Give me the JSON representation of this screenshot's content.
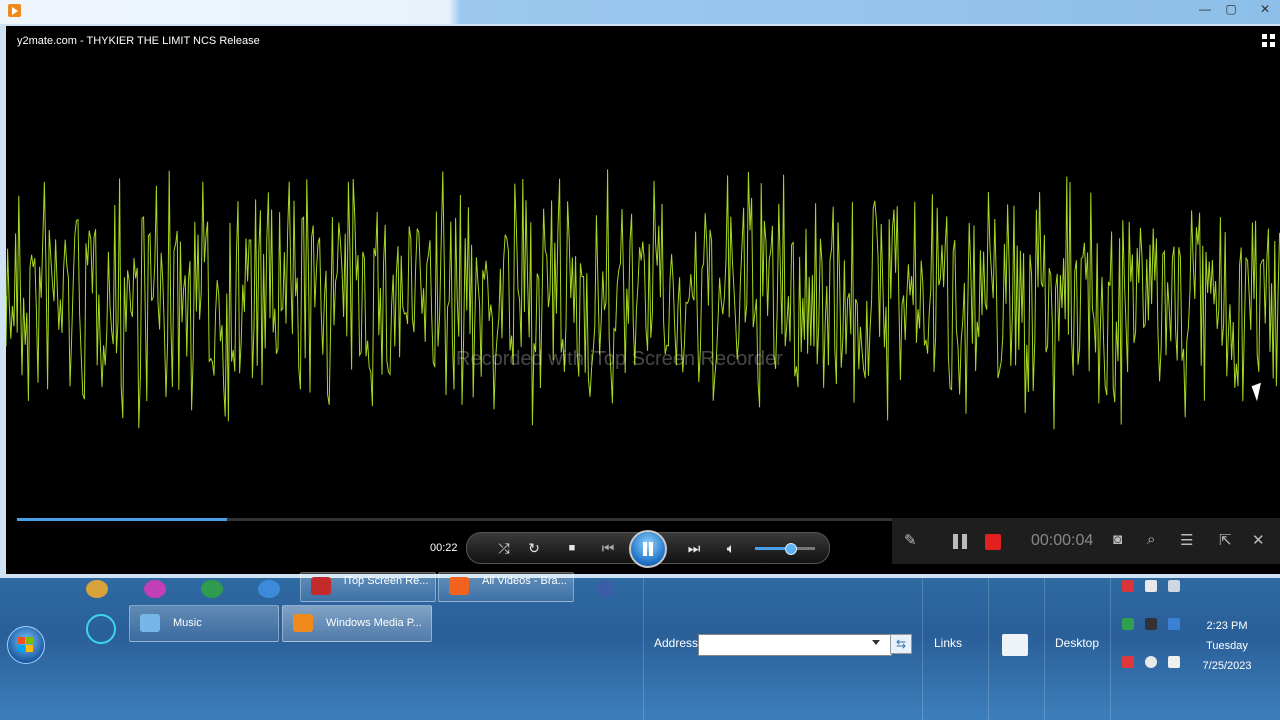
{
  "window": {
    "video_title": "y2mate.com - THYKIER  THE LIMIT NCS Release",
    "watermark": "Recorded with iTop Screen Recorder",
    "minimize": "—",
    "maximize": "▢",
    "close": "✕"
  },
  "player": {
    "elapsed": "00:22",
    "seek_progress": 0.24,
    "volume_level": 0.58,
    "icons": [
      "shuffle-icon",
      "repeat-icon",
      "stop-icon",
      "previous-icon",
      "pause-icon",
      "next-icon",
      "volume-icon"
    ]
  },
  "recorder": {
    "elapsed": "00:00:04",
    "stop_color": "#e32020"
  },
  "taskbar": {
    "buttons": {
      "itop": "iTop Screen Re...",
      "brave": "All Videos - Bra...",
      "music": "Music",
      "wmp": "Windows Media P..."
    },
    "address_label": "Address",
    "address_value": "",
    "links_label": "Links",
    "desktop_label": "Desktop",
    "clock": {
      "time": "2:23 PM",
      "day": "Tuesday",
      "date": "7/25/2023"
    }
  },
  "colors": {
    "waveform": "#a6d820",
    "accent": "#4aa0e6"
  }
}
